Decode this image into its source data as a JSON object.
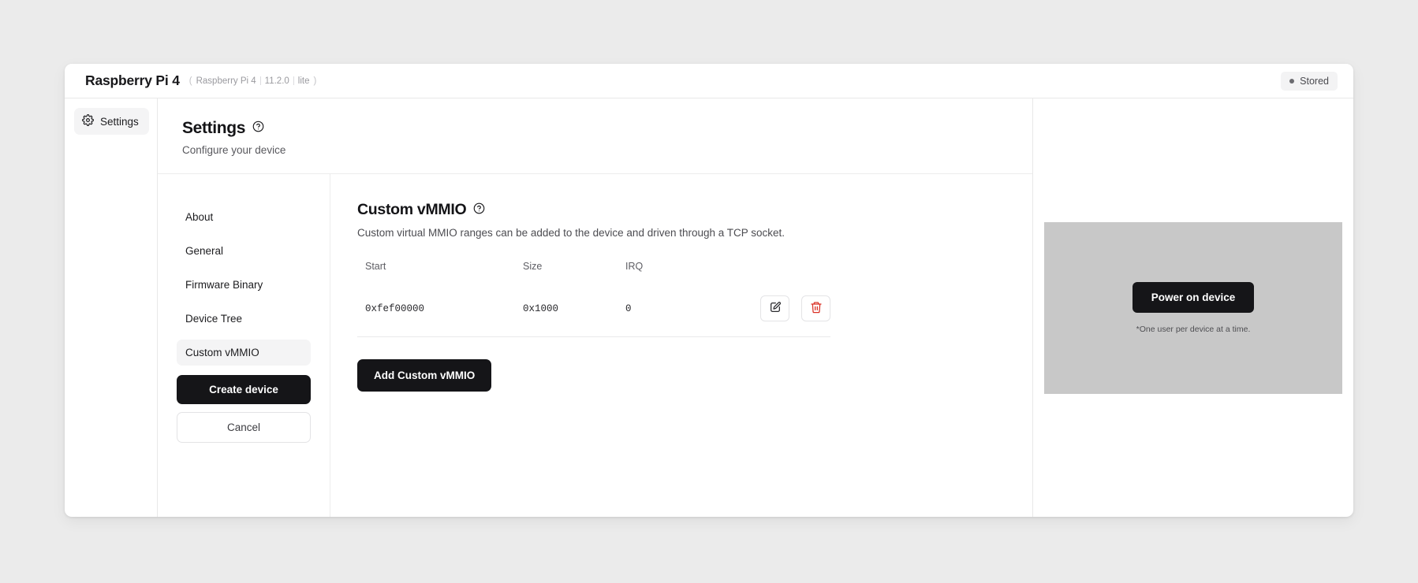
{
  "window": {
    "device_name": "Raspberry Pi 4",
    "meta": {
      "open_paren": "(",
      "model": "Raspberry Pi 4",
      "version": "11.2.0",
      "variant": "lite",
      "close_paren": ")"
    },
    "status_badge": {
      "label": "Stored",
      "dot_color": "#6b6b70",
      "background": "#f3f3f4"
    }
  },
  "rail": {
    "tabs": [
      {
        "label": "Settings",
        "icon": "gear-icon",
        "active": true
      }
    ]
  },
  "header": {
    "title": "Settings",
    "help_icon": "help-circle-icon",
    "subtitle": "Configure your device"
  },
  "nav": {
    "items": [
      {
        "label": "About",
        "active": false
      },
      {
        "label": "General",
        "active": false
      },
      {
        "label": "Firmware Binary",
        "active": false
      },
      {
        "label": "Device Tree",
        "active": false
      },
      {
        "label": "Custom vMMIO",
        "active": true
      }
    ],
    "create_button": "Create device",
    "cancel_button": "Cancel"
  },
  "content": {
    "title": "Custom vMMIO",
    "help_icon": "help-circle-icon",
    "description": "Custom virtual MMIO ranges can be added to the device and driven through a TCP socket.",
    "table": {
      "columns": [
        "Start",
        "Size",
        "IRQ"
      ],
      "rows": [
        {
          "start": "0xfef00000",
          "size": "0x1000",
          "irq": "0",
          "edit_icon": "edit-square-pencil-icon",
          "delete_icon": "trash-icon"
        }
      ]
    },
    "add_button": "Add Custom vMMIO"
  },
  "preview": {
    "power_button": "Power on device",
    "note": "*One user per device at a time.",
    "screen_color": "#c8c8c8"
  },
  "colors": {
    "accent_dark": "#151518",
    "danger": "#d93025",
    "page_background": "#ebebeb",
    "card_background": "#ffffff",
    "muted_text": "#9a9a9f"
  }
}
